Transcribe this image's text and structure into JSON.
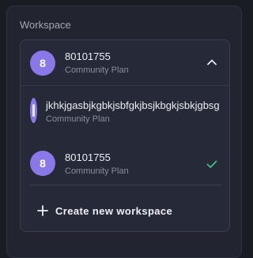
{
  "workspace": {
    "section_label": "Workspace",
    "selected": {
      "avatar_letter": "8",
      "name": "80101755",
      "plan": "Community Plan",
      "expanded_icon": "chevron-up-icon"
    },
    "items": [
      {
        "name": "jkhkjgasbjkgbkjsbfgkjbsjkbgkjsbkjgbsg",
        "plan": "Community Plan",
        "avatar_letter": "",
        "selected": false
      },
      {
        "name": "80101755",
        "plan": "Community Plan",
        "avatar_letter": "8",
        "selected": true,
        "selected_icon": "checkmark-icon"
      }
    ],
    "create_label": "Create new workspace",
    "create_icon": "plus-icon"
  },
  "colors": {
    "avatar": "#8b78e8",
    "check": "#3fbf86",
    "panel_bg": "#22242f",
    "dropdown_bg": "#262937"
  }
}
